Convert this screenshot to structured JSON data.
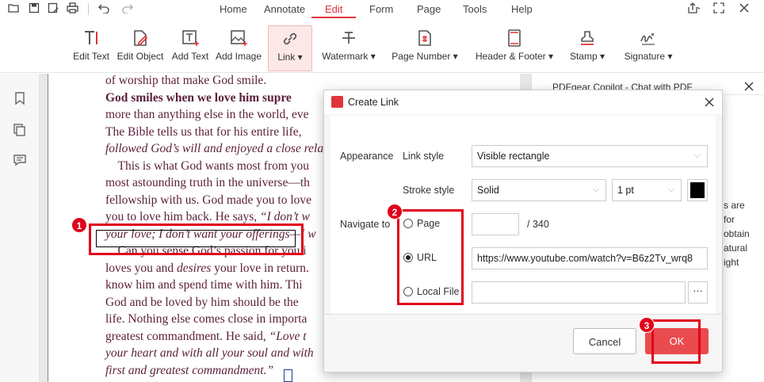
{
  "menu": {
    "tabs": [
      "Home",
      "Annotate",
      "Edit",
      "Form",
      "Page",
      "Tools",
      "Help"
    ],
    "active": "Edit"
  },
  "toolbar": {
    "tools": [
      "Edit Text",
      "Edit Object",
      "Add Text",
      "Add Image",
      "Link ▾",
      "Watermark ▾",
      "Page Number ▾",
      "Header & Footer ▾",
      "Stamp ▾",
      "Signature ▾"
    ]
  },
  "document": {
    "lines": [
      {
        "html": "of worship that make God smile."
      },
      {
        "html": "<b>God smiles when we love him supre</b>"
      },
      {
        "html": "more than anything else in the world, eve"
      },
      {
        "html": "The Bible tells us that for his entire life,"
      },
      {
        "html": "<i>followed God’s will and enjoyed a close rela</i>"
      },
      {
        "html": "    This is what God wants most from you"
      },
      {
        "html": "most astounding truth in the universe—th"
      },
      {
        "html": "fellowship with us. God made you to love"
      },
      {
        "html": "you to love him back. He says, <i>“I don’t w</i>"
      },
      {
        "html": "<i>your love; I don’t want your offerings—I w</i>"
      },
      {
        "html": "    Can you sense God’s passion for you i"
      },
      {
        "html": "loves you and <i>desires</i> your love in return."
      },
      {
        "html": "know him and spend time with him. Thi"
      },
      {
        "html": "God and be loved by him should be the"
      },
      {
        "html": "life. Nothing else comes close in importa"
      },
      {
        "html": "greatest commandment. He said, <i>“Love t</i>"
      },
      {
        "html": "<i>your heart and with all your soul and with</i>"
      },
      {
        "html": "<i>first and greatest commandment.”</i>"
      }
    ]
  },
  "copilot": {
    "title": "PDFgear Copilot - Chat with PDF",
    "snippets": [
      "s are",
      "for",
      "obtain",
      "atural",
      "ight"
    ]
  },
  "dialog": {
    "title": "Create Link",
    "appearance_label": "Appearance",
    "link_style_label": "Link style",
    "link_style_value": "Visible rectangle",
    "stroke_style_label": "Stroke style",
    "stroke_style_value": "Solid",
    "stroke_width_value": "1 pt",
    "stroke_color": "#000000",
    "navigate_label": "Navigate to",
    "page_option": "Page",
    "page_total": "/ 340",
    "url_option": "URL",
    "url_value": "https://www.youtube.com/watch?v=B6z2Tv_wrq8",
    "local_option": "Local File",
    "browse_label": "···",
    "cancel_label": "Cancel",
    "ok_label": "OK",
    "selected": "URL"
  },
  "callouts": [
    "1",
    "2",
    "3"
  ],
  "colors": {
    "accent": "#e0343b",
    "callout": "#e0001b",
    "doc_text": "#5b1f3a"
  }
}
